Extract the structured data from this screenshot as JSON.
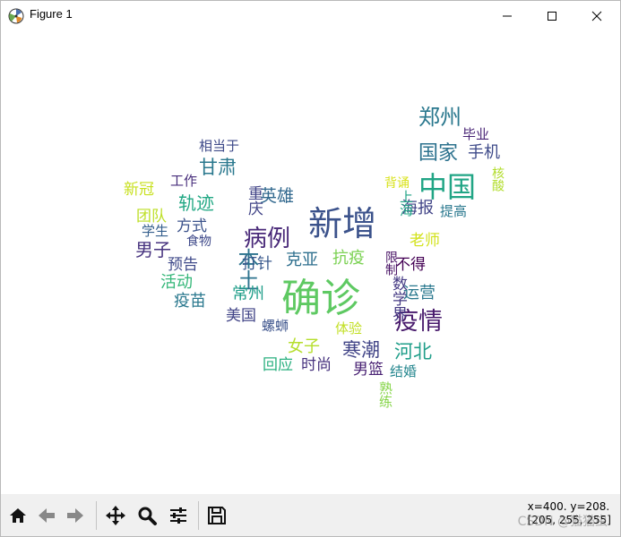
{
  "window": {
    "title": "Figure 1"
  },
  "icons": {
    "app": "matplotlib-icon",
    "minimize": "minimize-icon",
    "maximize": "maximize-icon",
    "close": "close-icon",
    "home": "home-icon",
    "back": "arrow-left-icon",
    "forward": "arrow-right-icon",
    "pan": "move-icon",
    "zoom": "magnifier-icon",
    "configure": "sliders-icon",
    "save": "floppy-disk-icon"
  },
  "wordcloud": {
    "words": [
      {
        "text": "新增",
        "color": "#3b528b"
      },
      {
        "text": "确诊",
        "color": "#5ec962"
      },
      {
        "text": "中国",
        "color": "#21a585"
      },
      {
        "text": "疫情",
        "color": "#481a6c"
      },
      {
        "text": "病例",
        "color": "#482878"
      },
      {
        "text": "本土",
        "color": "#2c738e"
      },
      {
        "text": "郑州",
        "color": "#2a788e"
      },
      {
        "text": "国家",
        "color": "#2c728e"
      },
      {
        "text": "寒潮",
        "color": "#414487"
      },
      {
        "text": "河北",
        "color": "#1f9e89"
      },
      {
        "text": "甘肃",
        "color": "#2a788e"
      },
      {
        "text": "轨迹",
        "color": "#22a884"
      },
      {
        "text": "手机",
        "color": "#3e4a89"
      },
      {
        "text": "海报",
        "color": "#414487"
      },
      {
        "text": "英雄",
        "color": "#31688e"
      },
      {
        "text": "男子",
        "color": "#46327e"
      },
      {
        "text": "抗疫",
        "color": "#7ad151"
      },
      {
        "text": "数学界",
        "color": "#443983"
      },
      {
        "text": "老师",
        "color": "#d2e21b"
      },
      {
        "text": "运营",
        "color": "#2a788e"
      },
      {
        "text": "女子",
        "color": "#b5de2b"
      },
      {
        "text": "男篮",
        "color": "#482173"
      },
      {
        "text": "克亚",
        "color": "#2e6f8e"
      },
      {
        "text": "打针",
        "color": "#38588c"
      },
      {
        "text": "方式",
        "color": "#3b528b"
      },
      {
        "text": "不得",
        "color": "#440154"
      },
      {
        "text": "团队",
        "color": "#bddf26"
      },
      {
        "text": "预告",
        "color": "#3e4989"
      },
      {
        "text": "活动",
        "color": "#35b779"
      },
      {
        "text": "疫苗",
        "color": "#2a788e"
      },
      {
        "text": "常州",
        "color": "#1f9e89"
      },
      {
        "text": "美国",
        "color": "#414487"
      },
      {
        "text": "回应",
        "color": "#2ab07f"
      },
      {
        "text": "时尚",
        "color": "#46327e"
      },
      {
        "text": "新冠",
        "color": "#c8e020"
      },
      {
        "text": "工作",
        "color": "#472d7b"
      },
      {
        "text": "学生",
        "color": "#355f8d"
      },
      {
        "text": "食物",
        "color": "#3e4989"
      },
      {
        "text": "相当于",
        "color": "#3e4a89"
      },
      {
        "text": "重庆",
        "color": "#414487"
      },
      {
        "text": "上海",
        "color": "#20a386"
      },
      {
        "text": "毕业",
        "color": "#482475"
      },
      {
        "text": "背诵",
        "color": "#d8e219"
      },
      {
        "text": "提高",
        "color": "#2a788e"
      },
      {
        "text": "核酸",
        "color": "#b2dd2d"
      },
      {
        "text": "限制",
        "color": "#471164"
      },
      {
        "text": "螺蛳",
        "color": "#3b528b"
      },
      {
        "text": "体验",
        "color": "#c2df23"
      },
      {
        "text": "结婚",
        "color": "#24868e"
      },
      {
        "text": "熟练",
        "color": "#86d549"
      }
    ]
  },
  "status": {
    "coords": "x=400. y=208.",
    "value": "[205, 255, 255]"
  },
  "watermark": "CSDN @猫猫虫"
}
